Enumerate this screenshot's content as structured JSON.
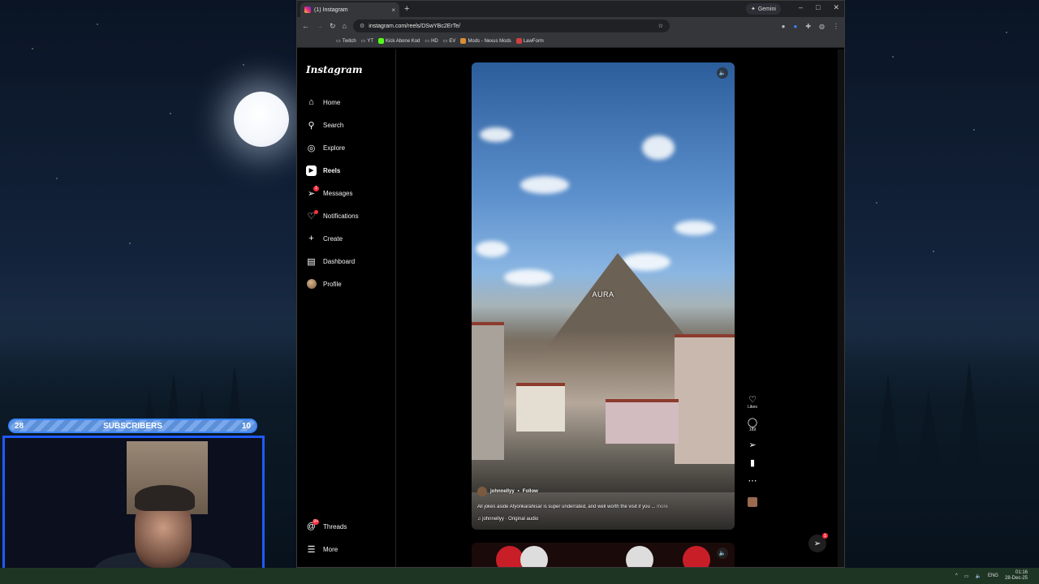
{
  "browser": {
    "tab_title": "(1) Instagram",
    "tab_close": "×",
    "new_tab": "+",
    "gemini_label": "Gemini",
    "url": "instagram.com/reels/DSwYBc2ErTe/",
    "window_controls": [
      "–",
      "□",
      "✕"
    ],
    "bookmarks": [
      {
        "label": "Twitch",
        "color": "#9a9a9a"
      },
      {
        "label": "YT",
        "color": "#9a9a9a"
      },
      {
        "label": "Kick Abone Kod",
        "color": "#53fc18"
      },
      {
        "label": "HD",
        "color": "#9a9a9a"
      },
      {
        "label": "EV",
        "color": "#9a9a9a"
      },
      {
        "label": "Mods - Nexus Mods",
        "color": "#da8e35"
      },
      {
        "label": "LawForm",
        "color": "#d13f3f"
      }
    ]
  },
  "instagram": {
    "logo": "Instagram",
    "nav": [
      {
        "label": "Home",
        "icon": "home-icon",
        "glyph": "⌂"
      },
      {
        "label": "Search",
        "icon": "search-icon",
        "glyph": "⚲"
      },
      {
        "label": "Explore",
        "icon": "compass-icon",
        "glyph": "◎"
      },
      {
        "label": "Reels",
        "icon": "reels-icon",
        "glyph": "▶"
      },
      {
        "label": "Messages",
        "icon": "messages-icon",
        "glyph": "➢",
        "badge": "1"
      },
      {
        "label": "Notifications",
        "icon": "heart-icon",
        "glyph": "♡"
      },
      {
        "label": "Create",
        "icon": "plus-icon",
        "glyph": "+"
      },
      {
        "label": "Dashboard",
        "icon": "dashboard-icon",
        "glyph": "▤"
      },
      {
        "label": "Profile",
        "icon": "avatar",
        "glyph": ""
      }
    ],
    "threads": {
      "label": "Threads",
      "badge": "9+"
    },
    "more": {
      "label": "More"
    },
    "reel": {
      "overlay_text": "AURA",
      "username": "johnnellyy",
      "follow": "Follow",
      "separator": "•",
      "caption": "All jokes aside Afyonkarahisar is super underrated, and well worth the visit if you ...",
      "more": "more",
      "audio": "♫ johnnellyy · Original audio",
      "likes_label": "Likes",
      "comments_count": "189"
    },
    "dm_badge": "1"
  },
  "stream": {
    "left_count": "28",
    "label": "SUBSCRIBERS",
    "right_count": "10"
  },
  "taskbar": {
    "lang": "ENG",
    "time": "01:16",
    "date": "28-Dec-25"
  }
}
